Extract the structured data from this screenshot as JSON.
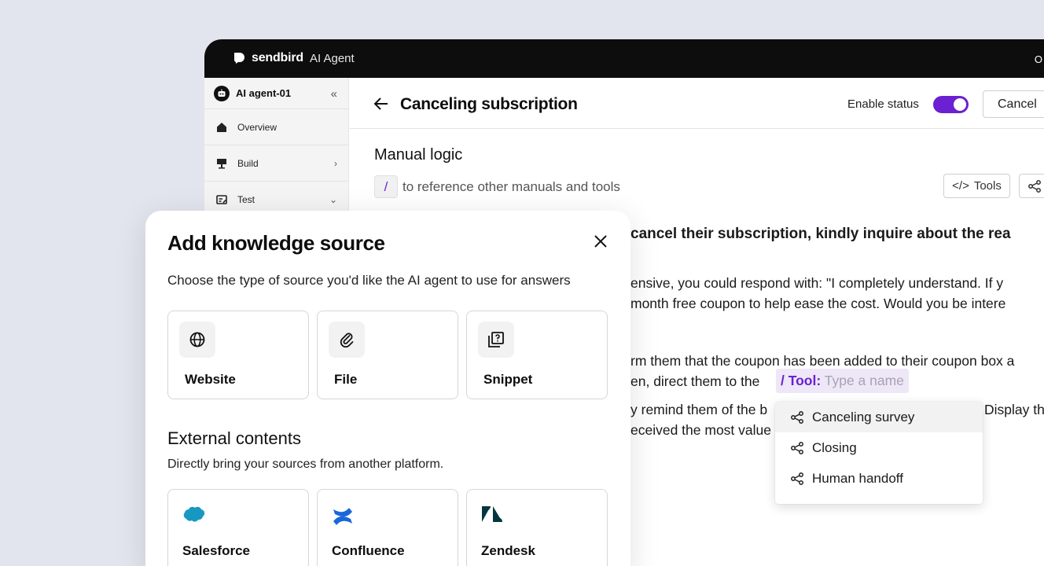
{
  "topbar": {
    "brand_name": "sendbird",
    "product": "AI Agent",
    "right_text": "O"
  },
  "sidebar": {
    "agent_name": "AI agent-01",
    "items": [
      {
        "label": "Overview",
        "icon": "home-icon"
      },
      {
        "label": "Build",
        "icon": "build-icon"
      },
      {
        "label": "Test",
        "icon": "test-icon"
      }
    ]
  },
  "header": {
    "title": "Canceling subscription",
    "enable_label": "Enable status",
    "enabled": true,
    "cancel_label": "Cancel"
  },
  "editor": {
    "section_title": "Manual logic",
    "slash": "/",
    "reference_hint": "to reference other manuals and tools",
    "tools_label": "Tools",
    "lines": [
      "cancel their subscription, kindly inquire about the rea",
      "ensive, you could respond with: \"I completely understand. If y",
      "month free coupon to help ease the cost. Would you be intere",
      "rm them that the coupon has been added to their coupon box a",
      "en, direct them to the",
      "y remind them of the b",
      "Display th",
      "eceived the most value"
    ],
    "tool_chip": {
      "prefix": "/ Tool:",
      "placeholder": "Type a name"
    },
    "dropdown": [
      "Canceling survey",
      "Closing",
      "Human handoff"
    ]
  },
  "modal": {
    "title": "Add knowledge source",
    "subtitle": "Choose the type of source you'd like the AI agent to use for answers",
    "sources": [
      {
        "label": "Website",
        "icon": "globe-icon"
      },
      {
        "label": "File",
        "icon": "paperclip-icon"
      },
      {
        "label": "Snippet",
        "icon": "snippet-icon"
      }
    ],
    "external_title": "External contents",
    "external_subtitle": "Directly bring your sources from another platform.",
    "external": [
      {
        "label": "Salesforce",
        "icon": "salesforce-logo"
      },
      {
        "label": "Confluence",
        "icon": "confluence-logo"
      },
      {
        "label": "Zendesk",
        "icon": "zendesk-logo"
      }
    ]
  },
  "colors": {
    "accent": "#6b21d1",
    "topbar": "#0d0d0d",
    "background": "#e3e5ee",
    "salesforce": "#1798c1",
    "confluence": "#1868db",
    "zendesk": "#03363d"
  }
}
